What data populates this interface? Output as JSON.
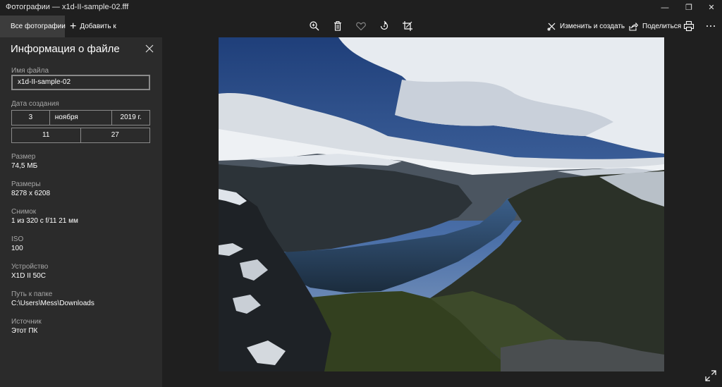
{
  "window": {
    "title": "Фотографии — x1d-II-sample-02.fff",
    "controls": {
      "minimize": "—",
      "maximize": "❐",
      "close": "✕"
    }
  },
  "toolbar": {
    "all_photos": "Все фотографии",
    "add_to": "Добавить к",
    "icons": [
      "zoom-in-icon",
      "delete-icon",
      "favorite-icon",
      "rotate-icon",
      "crop-icon"
    ],
    "edit_create": "Изменить и создать",
    "share": "Поделиться"
  },
  "info_panel": {
    "title": "Информация о файле",
    "file_name_label": "Имя файла",
    "file_name_value": "x1d-II-sample-02",
    "date_label": "Дата создания",
    "date": {
      "day": "3",
      "month": "ноября",
      "year": "2019 г.",
      "hour": "11",
      "minute": "27"
    },
    "size_label": "Размер",
    "size_value": "74,5 МБ",
    "dimensions_label": "Размеры",
    "dimensions_value": "8278 x 6208",
    "shot_label": "Снимок",
    "shot_value": "1 из 320 с f/11 21 мм",
    "iso_label": "ISO",
    "iso_value": "100",
    "device_label": "Устройство",
    "device_value": "X1D II 50C",
    "folder_label": "Путь к папке",
    "folder_value": "C:\\Users\\Mess\\Downloads",
    "source_label": "Источник",
    "source_value": "Этот ПК"
  },
  "colors": {
    "background": "#1f1f1f",
    "sidebar": "#2b2b2b",
    "selected_tab": "#3c3c3c",
    "label_gray": "#a6a6a6"
  }
}
